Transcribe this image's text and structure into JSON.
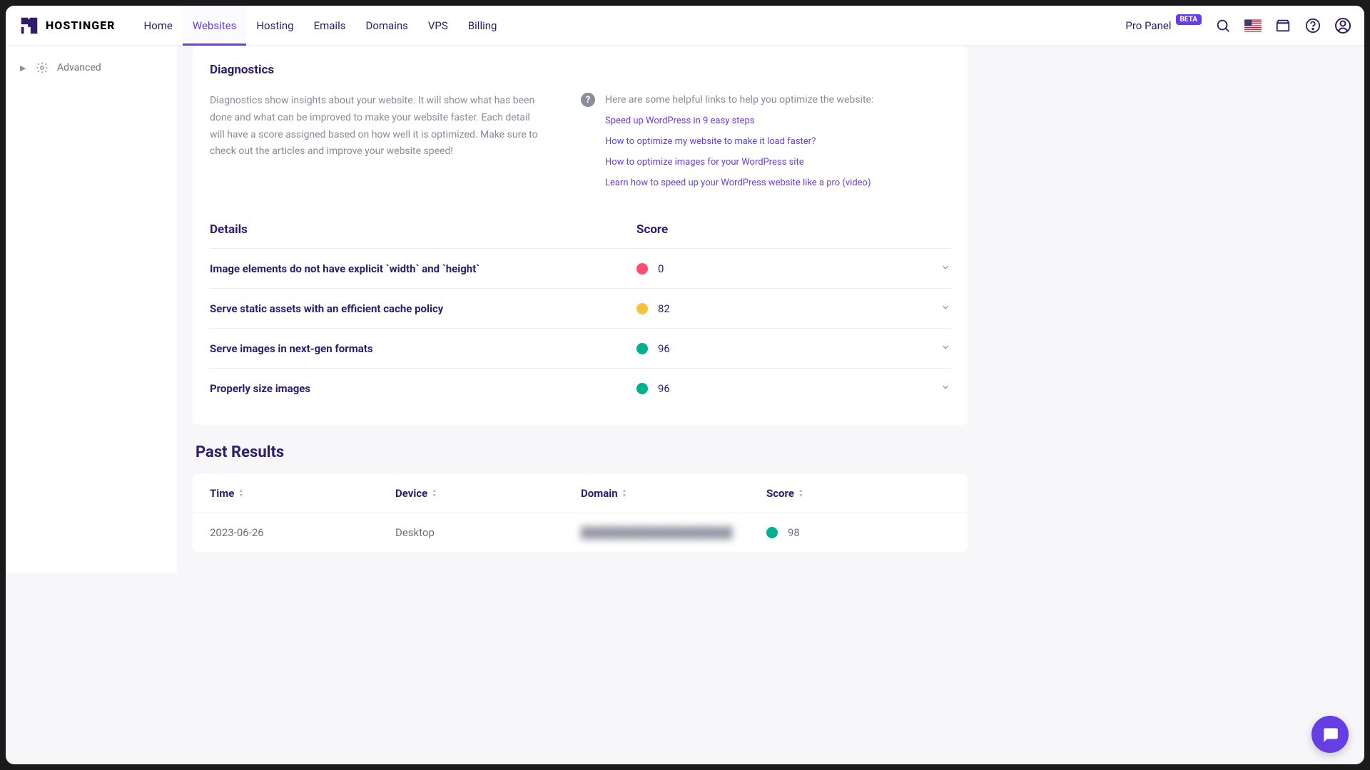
{
  "brand": {
    "name": "HOSTINGER"
  },
  "nav": {
    "items": [
      "Home",
      "Websites",
      "Hosting",
      "Emails",
      "Domains",
      "VPS",
      "Billing"
    ],
    "active_index": 1
  },
  "header": {
    "pro_panel": "Pro Panel",
    "beta": "BETA"
  },
  "sidebar": {
    "advanced": "Advanced"
  },
  "diagnostics": {
    "title": "Diagnostics",
    "description": "Diagnostics show insights about your website. It will show what has been done and what can be improved to make your website faster. Each detail will have a score assigned based on how well it is optimized. Make sure to check out the articles and improve your website speed!",
    "help_intro": "Here are some helpful links to help you optimize the website:",
    "help_links": [
      "Speed up WordPress in 9 easy steps",
      "How to optimize my website to make it load faster?",
      "How to optimize images for your WordPress site",
      "Learn how to speed up your WordPress website like a pro (video)"
    ],
    "details_title": "Details",
    "score_title": "Score",
    "rows": [
      {
        "label": "Image elements do not have explicit `width` and `height`",
        "score": "0",
        "color": "red"
      },
      {
        "label": "Serve static assets with an efficient cache policy",
        "score": "82",
        "color": "yellow"
      },
      {
        "label": "Serve images in next-gen formats",
        "score": "96",
        "color": "green"
      },
      {
        "label": "Properly size images",
        "score": "96",
        "color": "green"
      }
    ]
  },
  "past_results": {
    "title": "Past Results",
    "headers": {
      "time": "Time",
      "device": "Device",
      "domain": "Domain",
      "score": "Score"
    },
    "rows": [
      {
        "time": "2023-06-26",
        "device": "Desktop",
        "domain": "████████████████████",
        "score": "98",
        "color": "green"
      }
    ]
  }
}
